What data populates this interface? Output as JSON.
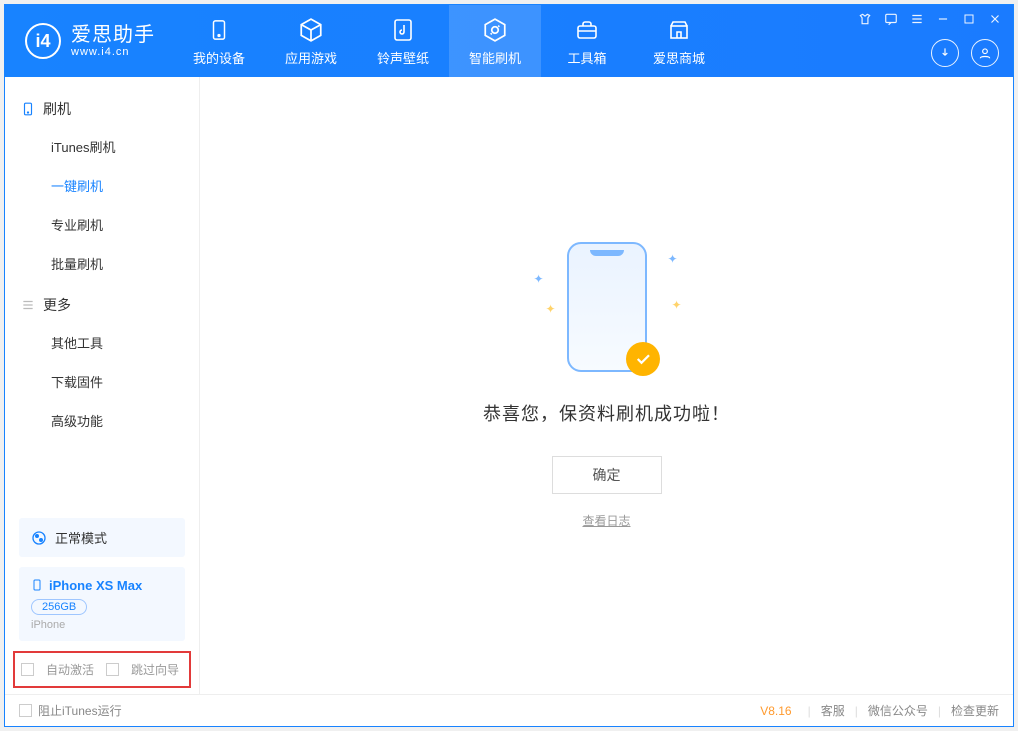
{
  "brand": {
    "main": "爱思助手",
    "sub": "www.i4.cn",
    "logo_text": "i4"
  },
  "tabs": [
    {
      "label": "我的设备",
      "icon": "phone-icon"
    },
    {
      "label": "应用游戏",
      "icon": "cube-icon"
    },
    {
      "label": "铃声壁纸",
      "icon": "music-icon"
    },
    {
      "label": "智能刷机",
      "icon": "refresh-icon",
      "active": true
    },
    {
      "label": "工具箱",
      "icon": "toolbox-icon"
    },
    {
      "label": "爱思商城",
      "icon": "store-icon"
    }
  ],
  "sidebar": {
    "section1": {
      "title": "刷机",
      "icon": "device-icon",
      "items": [
        {
          "label": "iTunes刷机"
        },
        {
          "label": "一键刷机",
          "active": true
        },
        {
          "label": "专业刷机"
        },
        {
          "label": "批量刷机"
        }
      ]
    },
    "section2": {
      "title": "更多",
      "icon": "list-icon",
      "items": [
        {
          "label": "其他工具"
        },
        {
          "label": "下载固件"
        },
        {
          "label": "高级功能"
        }
      ]
    }
  },
  "mode": {
    "label": "正常模式"
  },
  "device": {
    "name": "iPhone XS Max",
    "storage": "256GB",
    "type": "iPhone"
  },
  "options": {
    "auto_activate": "自动激活",
    "skip_guide": "跳过向导"
  },
  "main": {
    "message": "恭喜您，保资料刷机成功啦！",
    "ok_label": "确定",
    "log_link": "查看日志"
  },
  "footer": {
    "block_itunes": "阻止iTunes运行",
    "version": "V8.16",
    "links": [
      "客服",
      "微信公众号",
      "检查更新"
    ]
  }
}
